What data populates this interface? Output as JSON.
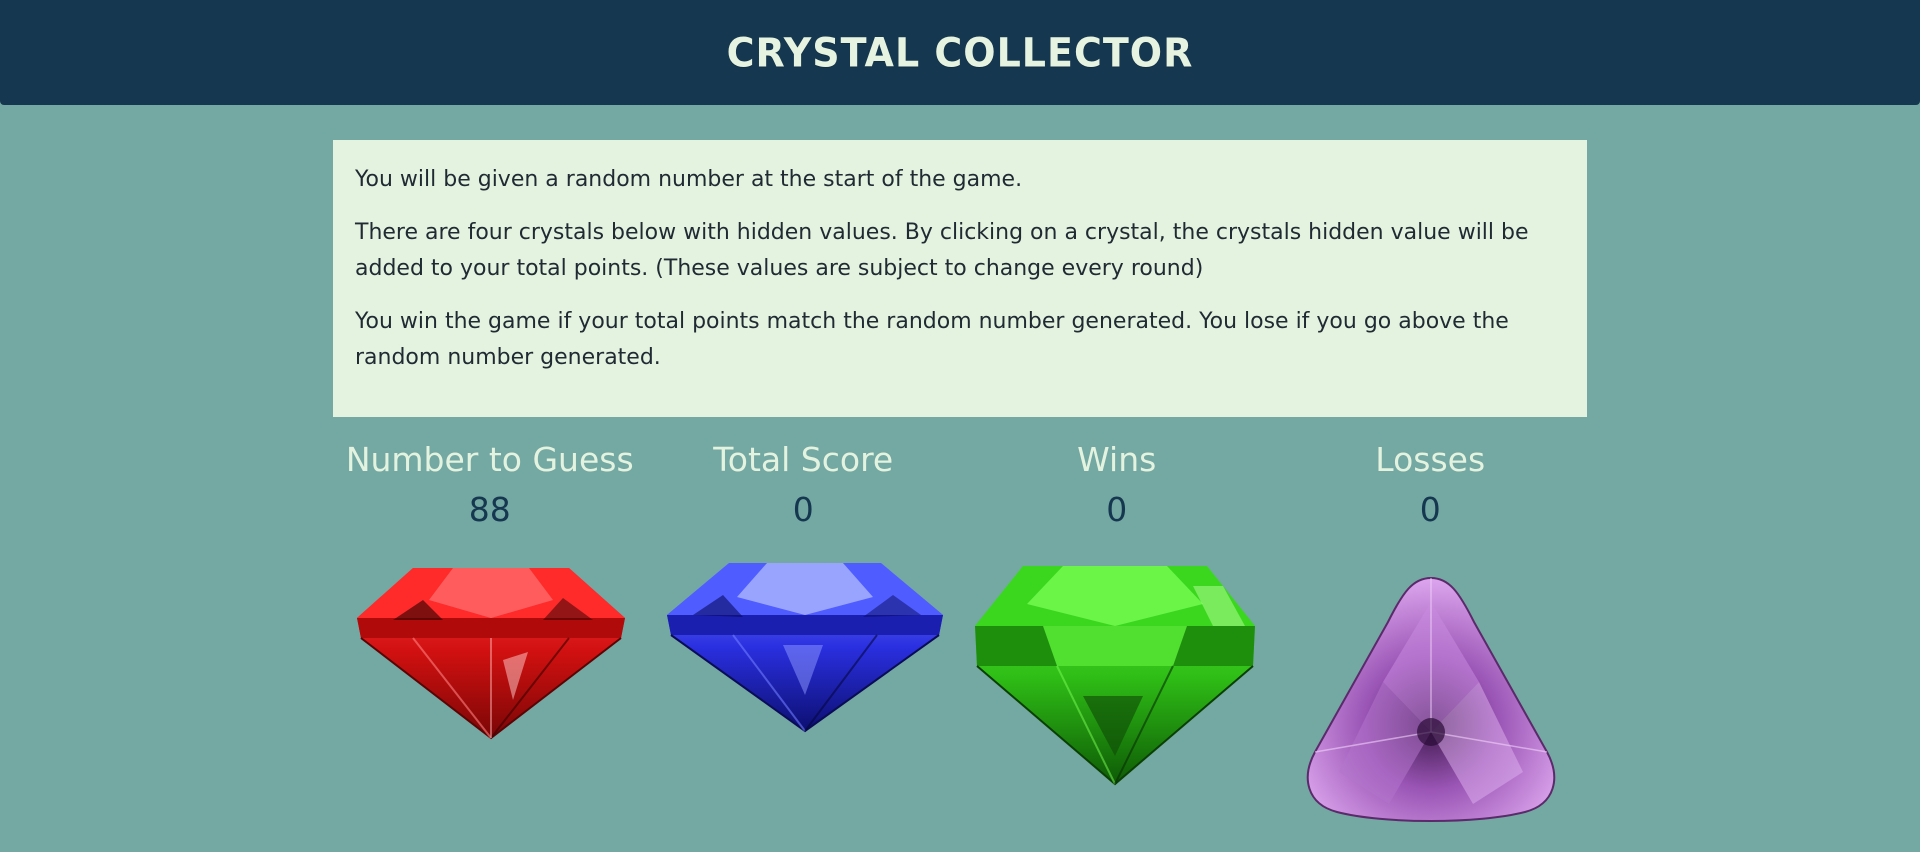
{
  "header": {
    "title": "CRYSTAL COLLECTOR"
  },
  "instructions": {
    "paragraphs": [
      "You will be given a random number at the start of the game.",
      "There are four crystals below with hidden values. By clicking on a crystal, the crystals hidden value will be added to your total points. (These values are subject to change every round)",
      "You win the game if your total points match the random number generated. You lose if you go above the random number generated."
    ]
  },
  "stats": {
    "number_to_guess": {
      "label": "Number to Guess",
      "value": "88"
    },
    "total_score": {
      "label": "Total Score",
      "value": "0"
    },
    "wins": {
      "label": "Wins",
      "value": "0"
    },
    "losses": {
      "label": "Losses",
      "value": "0"
    }
  },
  "crystals": [
    {
      "name": "red-crystal",
      "color": "#e01e1e"
    },
    {
      "name": "blue-crystal",
      "color": "#2a2fe0"
    },
    {
      "name": "green-crystal",
      "color": "#2fbf16"
    },
    {
      "name": "purple-crystal",
      "color": "#c07ad6"
    }
  ],
  "colors": {
    "background": "#73a8a3",
    "header_bg": "#15374f",
    "panel_bg": "#e4f3e0",
    "label_text": "#e4f3e0",
    "value_text": "#15374f"
  }
}
